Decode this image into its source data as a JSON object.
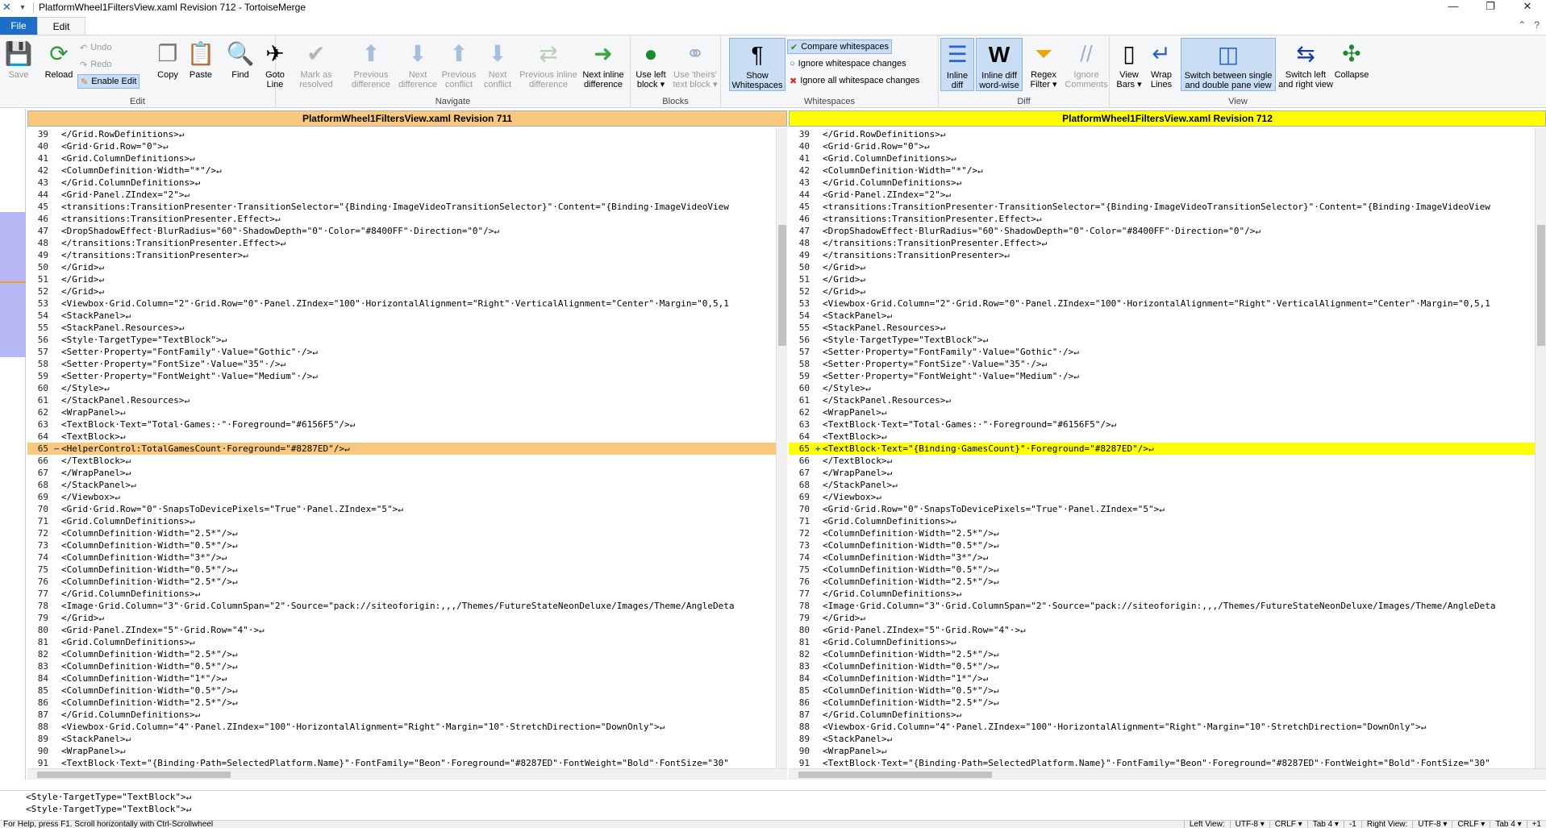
{
  "window": {
    "title": "PlatformWheel1FiltersView.xaml Revision 712 - TortoiseMerge",
    "minimize": "—",
    "maximize": "❐",
    "close": "✕"
  },
  "tabs": {
    "file": "File",
    "edit": "Edit"
  },
  "ribbon": {
    "edit_group": {
      "label": "Edit",
      "save": "Save",
      "reload": "Reload",
      "undo": "Undo",
      "redo": "Redo",
      "enable_edit": "Enable Edit",
      "copy": "Copy",
      "paste": "Paste",
      "find": "Find",
      "goto_line": "Goto\nLine",
      "mark_resolved": "Mark as\nresolved"
    },
    "navigate_group": {
      "label": "Navigate",
      "prev_diff": "Previous\ndifference",
      "next_diff": "Next\ndifference",
      "prev_conflict": "Previous\nconflict",
      "next_conflict": "Next\nconflict",
      "prev_inline": "Previous inline\ndifference",
      "next_inline": "Next inline\ndifference"
    },
    "blocks_group": {
      "label": "Blocks",
      "use_left": "Use left\nblock ▾",
      "use_theirs": "Use 'theirs'\ntext block ▾"
    },
    "whitespaces_group": {
      "label": "Whitespaces",
      "show_ws": "Show\nWhitespaces",
      "compare_ws": "Compare whitespaces",
      "ignore_ws_changes": "Ignore whitespace changes",
      "ignore_all_ws": "Ignore all whitespace changes"
    },
    "diff_group": {
      "label": "Diff",
      "inline_diff": "Inline\ndiff",
      "inline_diff_word": "Inline diff\nword-wise",
      "regex_filter": "Regex\nFilter ▾",
      "ignore_comments": "Ignore\nComments"
    },
    "view_group": {
      "label": "View",
      "view_bars": "View\nBars ▾",
      "wrap_lines": "Wrap\nLines",
      "switch_single_double": "Switch between single\nand double pane view",
      "switch_left_right": "Switch left\nand right view",
      "collapse": "Collapse"
    }
  },
  "left_pane": {
    "header": "PlatformWheel1FiltersView.xaml Revision 711",
    "lines": [
      {
        "n": "39",
        "t": "</Grid.RowDefinitions>↵"
      },
      {
        "n": "40",
        "t": "<Grid·Grid.Row=\"0\">↵"
      },
      {
        "n": "41",
        "t": "<Grid.ColumnDefinitions>↵"
      },
      {
        "n": "42",
        "t": "<ColumnDefinition·Width=\"*\"/>↵"
      },
      {
        "n": "43",
        "t": "</Grid.ColumnDefinitions>↵"
      },
      {
        "n": "44",
        "t": "<Grid·Panel.ZIndex=\"2\">↵"
      },
      {
        "n": "45",
        "t": "<transitions:TransitionPresenter·TransitionSelector=\"{Binding·ImageVideoTransitionSelector}\"·Content=\"{Binding·ImageVideoView"
      },
      {
        "n": "46",
        "t": "<transitions:TransitionPresenter.Effect>↵"
      },
      {
        "n": "47",
        "t": "<DropShadowEffect·BlurRadius=\"60\"·ShadowDepth=\"0\"·Color=\"#8400FF\"·Direction=\"0\"/>↵"
      },
      {
        "n": "48",
        "t": "</transitions:TransitionPresenter.Effect>↵"
      },
      {
        "n": "49",
        "t": "</transitions:TransitionPresenter>↵"
      },
      {
        "n": "50",
        "t": "</Grid>↵"
      },
      {
        "n": "51",
        "t": "</Grid>↵"
      },
      {
        "n": "52",
        "t": "</Grid>↵"
      },
      {
        "n": "53",
        "t": "<Viewbox·Grid.Column=\"2\"·Grid.Row=\"0\"·Panel.ZIndex=\"100\"·HorizontalAlignment=\"Right\"·VerticalAlignment=\"Center\"·Margin=\"0,5,1"
      },
      {
        "n": "54",
        "t": "<StackPanel>↵"
      },
      {
        "n": "55",
        "t": "<StackPanel.Resources>↵"
      },
      {
        "n": "56",
        "t": "<Style·TargetType=\"TextBlock\">↵"
      },
      {
        "n": "57",
        "t": "<Setter·Property=\"FontFamily\"·Value=\"Gothic\"·/>↵"
      },
      {
        "n": "58",
        "t": "<Setter·Property=\"FontSize\"·Value=\"35\"·/>↵"
      },
      {
        "n": "59",
        "t": "<Setter·Property=\"FontWeight\"·Value=\"Medium\"·/>↵"
      },
      {
        "n": "60",
        "t": "</Style>↵"
      },
      {
        "n": "61",
        "t": "</StackPanel.Resources>↵"
      },
      {
        "n": "62",
        "t": "<WrapPanel>↵"
      },
      {
        "n": "63",
        "t": "<TextBlock·Text=\"Total·Games:·\"·Foreground=\"#6156F5\"/>↵"
      },
      {
        "n": "64",
        "t": "<TextBlock>↵"
      },
      {
        "n": "65",
        "t": "<HelperControl:TotalGamesCount·Foreground=\"#8287ED\"/>↵",
        "changed": true,
        "mark": "−"
      },
      {
        "n": "66",
        "t": "</TextBlock>↵"
      },
      {
        "n": "67",
        "t": "</WrapPanel>↵"
      },
      {
        "n": "68",
        "t": "</StackPanel>↵"
      },
      {
        "n": "69",
        "t": "</Viewbox>↵"
      },
      {
        "n": "70",
        "t": "<Grid·Grid.Row=\"0\"·SnapsToDevicePixels=\"True\"·Panel.ZIndex=\"5\">↵"
      },
      {
        "n": "71",
        "t": "<Grid.ColumnDefinitions>↵"
      },
      {
        "n": "72",
        "t": "<ColumnDefinition·Width=\"2.5*\"/>↵"
      },
      {
        "n": "73",
        "t": "<ColumnDefinition·Width=\"0.5*\"/>↵"
      },
      {
        "n": "74",
        "t": "<ColumnDefinition·Width=\"3*\"/>↵"
      },
      {
        "n": "75",
        "t": "<ColumnDefinition·Width=\"0.5*\"/>↵"
      },
      {
        "n": "76",
        "t": "<ColumnDefinition·Width=\"2.5*\"/>↵"
      },
      {
        "n": "77",
        "t": "</Grid.ColumnDefinitions>↵"
      },
      {
        "n": "78",
        "t": "<Image·Grid.Column=\"3\"·Grid.ColumnSpan=\"2\"·Source=\"pack://siteoforigin:,,,/Themes/FutureStateNeonDeluxe/Images/Theme/AngleDeta"
      },
      {
        "n": "79",
        "t": "</Grid>↵"
      },
      {
        "n": "80",
        "t": "<Grid·Panel.ZIndex=\"5\"·Grid.Row=\"4\"·>↵"
      },
      {
        "n": "81",
        "t": "<Grid.ColumnDefinitions>↵"
      },
      {
        "n": "82",
        "t": "<ColumnDefinition·Width=\"2.5*\"/>↵"
      },
      {
        "n": "83",
        "t": "<ColumnDefinition·Width=\"0.5*\"/>↵"
      },
      {
        "n": "84",
        "t": "<ColumnDefinition·Width=\"1*\"/>↵"
      },
      {
        "n": "85",
        "t": "<ColumnDefinition·Width=\"0.5*\"/>↵"
      },
      {
        "n": "86",
        "t": "<ColumnDefinition·Width=\"2.5*\"/>↵"
      },
      {
        "n": "87",
        "t": "</Grid.ColumnDefinitions>↵"
      },
      {
        "n": "88",
        "t": "<Viewbox·Grid.Column=\"4\"·Panel.ZIndex=\"100\"·HorizontalAlignment=\"Right\"·Margin=\"10\"·StretchDirection=\"DownOnly\">↵"
      },
      {
        "n": "89",
        "t": "<StackPanel>↵"
      },
      {
        "n": "90",
        "t": "<WrapPanel>↵"
      },
      {
        "n": "91",
        "t": "<TextBlock·Text=\"{Binding·Path=SelectedPlatform.Name}\"·FontFamily=\"Beon\"·Foreground=\"#8287ED\"·FontWeight=\"Bold\"·FontSize=\"30\""
      }
    ]
  },
  "right_pane": {
    "header": "PlatformWheel1FiltersView.xaml Revision 712",
    "lines": [
      {
        "n": "39",
        "t": "</Grid.RowDefinitions>↵"
      },
      {
        "n": "40",
        "t": "<Grid·Grid.Row=\"0\">↵"
      },
      {
        "n": "41",
        "t": "<Grid.ColumnDefinitions>↵"
      },
      {
        "n": "42",
        "t": "<ColumnDefinition·Width=\"*\"/>↵"
      },
      {
        "n": "43",
        "t": "</Grid.ColumnDefinitions>↵"
      },
      {
        "n": "44",
        "t": "<Grid·Panel.ZIndex=\"2\">↵"
      },
      {
        "n": "45",
        "t": "<transitions:TransitionPresenter·TransitionSelector=\"{Binding·ImageVideoTransitionSelector}\"·Content=\"{Binding·ImageVideoView"
      },
      {
        "n": "46",
        "t": "<transitions:TransitionPresenter.Effect>↵"
      },
      {
        "n": "47",
        "t": "<DropShadowEffect·BlurRadius=\"60\"·ShadowDepth=\"0\"·Color=\"#8400FF\"·Direction=\"0\"/>↵"
      },
      {
        "n": "48",
        "t": "</transitions:TransitionPresenter.Effect>↵"
      },
      {
        "n": "49",
        "t": "</transitions:TransitionPresenter>↵"
      },
      {
        "n": "50",
        "t": "</Grid>↵"
      },
      {
        "n": "51",
        "t": "</Grid>↵"
      },
      {
        "n": "52",
        "t": "</Grid>↵"
      },
      {
        "n": "53",
        "t": "<Viewbox·Grid.Column=\"2\"·Grid.Row=\"0\"·Panel.ZIndex=\"100\"·HorizontalAlignment=\"Right\"·VerticalAlignment=\"Center\"·Margin=\"0,5,1"
      },
      {
        "n": "54",
        "t": "<StackPanel>↵"
      },
      {
        "n": "55",
        "t": "<StackPanel.Resources>↵"
      },
      {
        "n": "56",
        "t": "<Style·TargetType=\"TextBlock\">↵"
      },
      {
        "n": "57",
        "t": "<Setter·Property=\"FontFamily\"·Value=\"Gothic\"·/>↵"
      },
      {
        "n": "58",
        "t": "<Setter·Property=\"FontSize\"·Value=\"35\"·/>↵"
      },
      {
        "n": "59",
        "t": "<Setter·Property=\"FontWeight\"·Value=\"Medium\"·/>↵"
      },
      {
        "n": "60",
        "t": "</Style>↵"
      },
      {
        "n": "61",
        "t": "</StackPanel.Resources>↵"
      },
      {
        "n": "62",
        "t": "<WrapPanel>↵"
      },
      {
        "n": "63",
        "t": "<TextBlock·Text=\"Total·Games:·\"·Foreground=\"#6156F5\"/>↵"
      },
      {
        "n": "64",
        "t": "<TextBlock>↵"
      },
      {
        "n": "65",
        "t": "<TextBlock·Text=\"{Binding·GamesCount}\"·Foreground=\"#8287ED\"/>↵",
        "changed": true,
        "mark": "+"
      },
      {
        "n": "66",
        "t": "</TextBlock>↵"
      },
      {
        "n": "67",
        "t": "</WrapPanel>↵"
      },
      {
        "n": "68",
        "t": "</StackPanel>↵"
      },
      {
        "n": "69",
        "t": "</Viewbox>↵"
      },
      {
        "n": "70",
        "t": "<Grid·Grid.Row=\"0\"·SnapsToDevicePixels=\"True\"·Panel.ZIndex=\"5\">↵"
      },
      {
        "n": "71",
        "t": "<Grid.ColumnDefinitions>↵"
      },
      {
        "n": "72",
        "t": "<ColumnDefinition·Width=\"2.5*\"/>↵"
      },
      {
        "n": "73",
        "t": "<ColumnDefinition·Width=\"0.5*\"/>↵"
      },
      {
        "n": "74",
        "t": "<ColumnDefinition·Width=\"3*\"/>↵"
      },
      {
        "n": "75",
        "t": "<ColumnDefinition·Width=\"0.5*\"/>↵"
      },
      {
        "n": "76",
        "t": "<ColumnDefinition·Width=\"2.5*\"/>↵"
      },
      {
        "n": "77",
        "t": "</Grid.ColumnDefinitions>↵"
      },
      {
        "n": "78",
        "t": "<Image·Grid.Column=\"3\"·Grid.ColumnSpan=\"2\"·Source=\"pack://siteoforigin:,,,/Themes/FutureStateNeonDeluxe/Images/Theme/AngleDeta"
      },
      {
        "n": "79",
        "t": "</Grid>↵"
      },
      {
        "n": "80",
        "t": "<Grid·Panel.ZIndex=\"5\"·Grid.Row=\"4\"·>↵"
      },
      {
        "n": "81",
        "t": "<Grid.ColumnDefinitions>↵"
      },
      {
        "n": "82",
        "t": "<ColumnDefinition·Width=\"2.5*\"/>↵"
      },
      {
        "n": "83",
        "t": "<ColumnDefinition·Width=\"0.5*\"/>↵"
      },
      {
        "n": "84",
        "t": "<ColumnDefinition·Width=\"1*\"/>↵"
      },
      {
        "n": "85",
        "t": "<ColumnDefinition·Width=\"0.5*\"/>↵"
      },
      {
        "n": "86",
        "t": "<ColumnDefinition·Width=\"2.5*\"/>↵"
      },
      {
        "n": "87",
        "t": "</Grid.ColumnDefinitions>↵"
      },
      {
        "n": "88",
        "t": "<Viewbox·Grid.Column=\"4\"·Panel.ZIndex=\"100\"·HorizontalAlignment=\"Right\"·Margin=\"10\"·StretchDirection=\"DownOnly\">↵"
      },
      {
        "n": "89",
        "t": "<StackPanel>↵"
      },
      {
        "n": "90",
        "t": "<WrapPanel>↵"
      },
      {
        "n": "91",
        "t": "<TextBlock·Text=\"{Binding·Path=SelectedPlatform.Name}\"·FontFamily=\"Beon\"·Foreground=\"#8287ED\"·FontWeight=\"Bold\"·FontSize=\"30\""
      }
    ]
  },
  "bottom_pane": {
    "lines": [
      "<Style·TargetType=\"TextBlock\">↵",
      "<Style·TargetType=\"TextBlock\">↵"
    ]
  },
  "status": {
    "message": "For Help, press F1. Scroll horizontally with Ctrl-Scrollwheel",
    "left_view": "Left View:",
    "left_enc": "UTF-8 ▾",
    "left_eol": "CRLF ▾",
    "left_tab": "Tab 4 ▾",
    "left_num": "-1",
    "right_view": "Right View:",
    "right_enc": "UTF-8 ▾",
    "right_eol": "CRLF ▾",
    "right_tab": "Tab 4 ▾",
    "right_num": "+1"
  },
  "colors": {
    "left_header": "#f7c87e",
    "right_header": "#ffff00",
    "accent": "#1e6ec8"
  }
}
